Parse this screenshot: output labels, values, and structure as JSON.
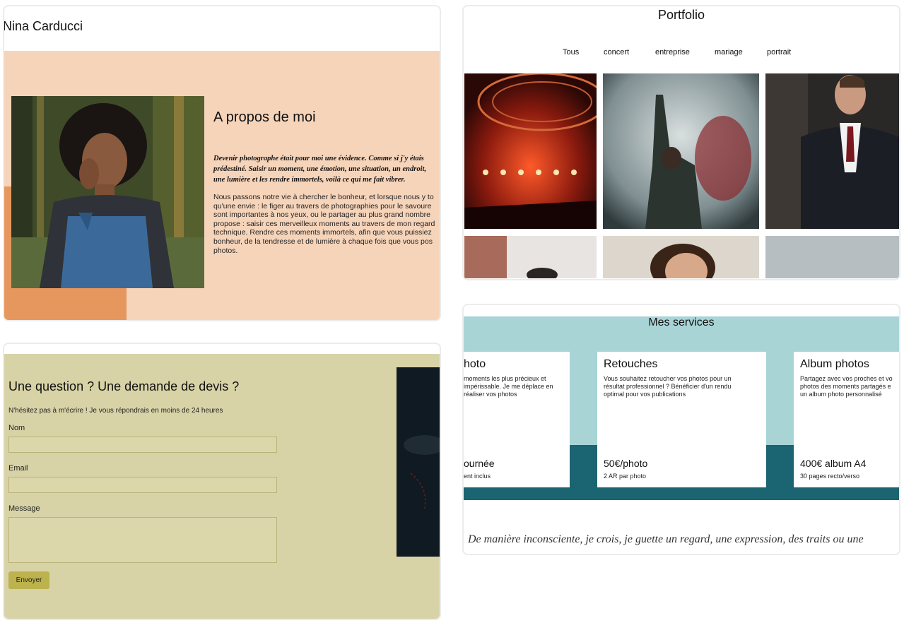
{
  "about": {
    "name": "Nina Carducci",
    "title": "A propos de moi",
    "lead": "Devenir photographe était pour moi une évidence. Comme si j'y étais prédestiné. Saisir un moment, une émotion, une situation, un endroit, une lumière et les rendre immortels, voilà ce qui me fait vibrer.",
    "body_lines": [
      "Nous passons notre vie à chercher le bonheur, et lorsque nous y to",
      "qu'une envie : le figer au travers de photographies pour le savoure",
      "sont importantes à nos yeux, ou le partager au plus grand nombre",
      "propose : saisir ces merveilleux moments au travers de mon regard",
      "technique. Rendre ces moments immortels, afin que vous puissiez",
      "bonheur, de la tendresse et de lumière à chaque fois que vous pos",
      "photos."
    ]
  },
  "portfolio": {
    "title": "Portfolio",
    "filters": [
      "Tous",
      "concert",
      "entreprise",
      "mariage",
      "portrait"
    ]
  },
  "contact": {
    "title": "Une question ? Une demande de devis ?",
    "subtitle": "N'hésitez pas à m'écrire ! Je vous répondrais en moins de 24 heures",
    "fields": {
      "name_label": "Nom",
      "email_label": "Email",
      "message_label": "Message"
    },
    "submit": "Envoyer"
  },
  "services": {
    "title": "Mes services",
    "items": [
      {
        "name": "hoto",
        "desc_lines": [
          "moments les plus précieux et",
          "impérissable. Je me déplace en",
          "réaliser vos photos"
        ],
        "price": "ournée",
        "note": "ent inclus"
      },
      {
        "name": "Retouches",
        "desc_lines": [
          "Vous souhaitez retoucher vos photos pour un",
          "résultat professionnel ? Bénéficier d'un rendu",
          "optimal pour vos publications"
        ],
        "price": "50€/photo",
        "note": "2 AR par photo"
      },
      {
        "name": "Album photos",
        "desc_lines": [
          "Partagez avec vos proches et vo",
          "photos des moments partagés e",
          "un album photo personnalisé"
        ],
        "price": "400€ album A4",
        "note": "30 pages recto/verso"
      }
    ],
    "quote": "De manière inconsciente, je crois, je guette un regard, une expression, des traits ou une"
  },
  "colors": {
    "peach": "#f6d4ba",
    "orange": "#e6975e",
    "olive": "#d8d3a7",
    "button": "#bcb24e",
    "teal_light": "#a8d4d6",
    "teal_dark": "#1b6472"
  }
}
